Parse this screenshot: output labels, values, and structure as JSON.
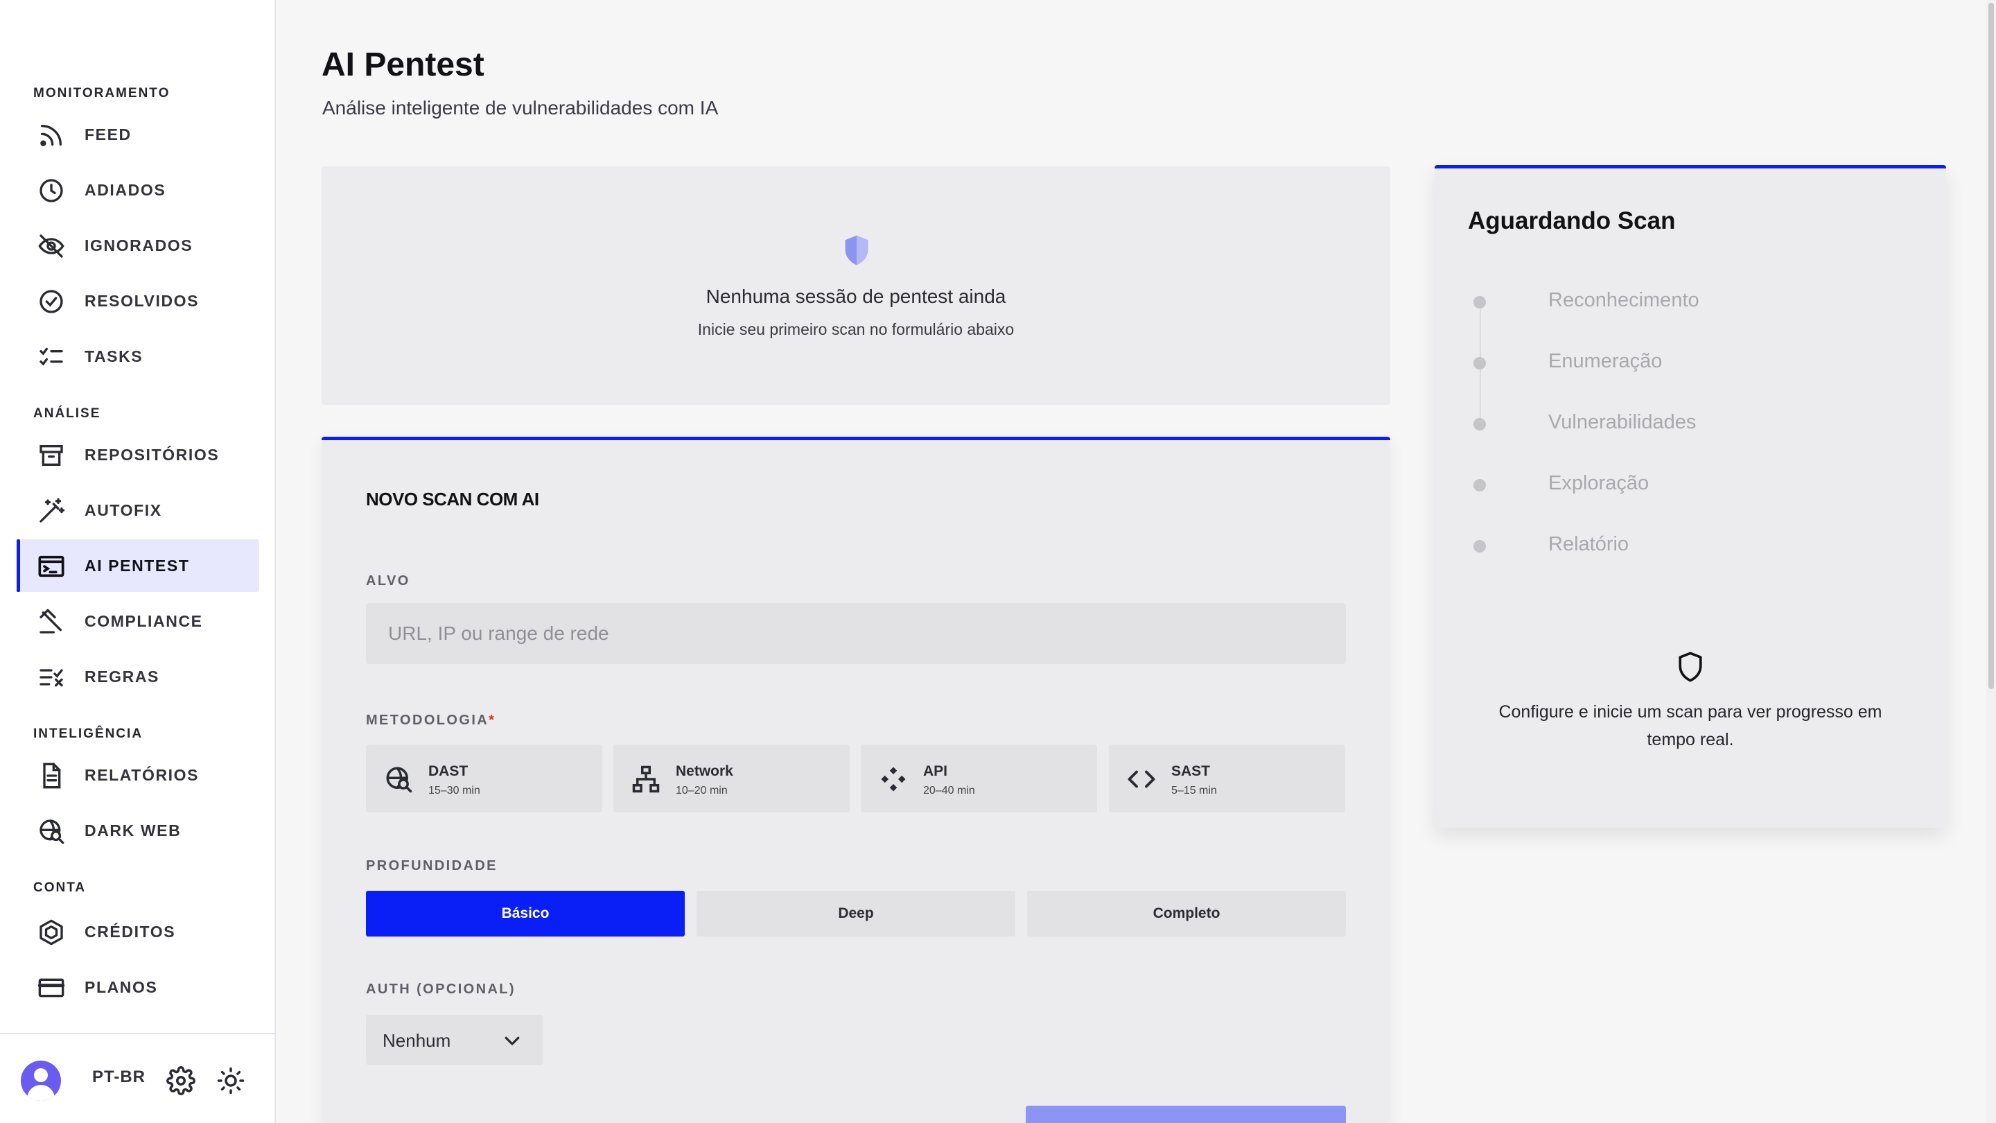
{
  "sidebar": {
    "sections": [
      {
        "title": "MONITORAMENTO",
        "items": [
          {
            "label": "FEED",
            "icon": "rss-icon"
          },
          {
            "label": "ADIADOS",
            "icon": "clock-icon"
          },
          {
            "label": "IGNORADOS",
            "icon": "eye-off-icon"
          },
          {
            "label": "RESOLVIDOS",
            "icon": "check-circle-icon"
          },
          {
            "label": "TASKS",
            "icon": "checklist-icon"
          }
        ]
      },
      {
        "title": "ANÁLISE",
        "items": [
          {
            "label": "REPOSITÓRIOS",
            "icon": "archive-icon"
          },
          {
            "label": "AUTOFIX",
            "icon": "magic-wand-icon"
          },
          {
            "label": "AI PENTEST",
            "icon": "terminal-icon",
            "active": true
          },
          {
            "label": "COMPLIANCE",
            "icon": "gavel-icon"
          },
          {
            "label": "REGRAS",
            "icon": "rules-icon"
          }
        ]
      },
      {
        "title": "INTELIGÊNCIA",
        "items": [
          {
            "label": "RELATÓRIOS",
            "icon": "document-icon"
          },
          {
            "label": "DARK WEB",
            "icon": "globe-search-icon"
          }
        ]
      },
      {
        "title": "CONTA",
        "items": [
          {
            "label": "CRÉDITOS",
            "icon": "coin-hexagon-icon"
          },
          {
            "label": "PLANOS",
            "icon": "credit-card-icon"
          }
        ]
      }
    ],
    "footer": {
      "language": "PT-BR",
      "settings_icon": "gear-icon",
      "theme_icon": "sun-icon",
      "avatar_icon": "user-avatar-icon"
    }
  },
  "header": {
    "title": "AI Pentest",
    "subtitle": "Análise inteligente de vulnerabilidades com IA"
  },
  "empty_state": {
    "icon": "shield-icon",
    "title": "Nenhuma sessão de pentest ainda",
    "subtitle": "Inicie seu primeiro scan no formulário abaixo"
  },
  "scan_form": {
    "title": "NOVO SCAN COM AI",
    "target": {
      "label": "ALVO",
      "value": "",
      "placeholder": "URL, IP ou range de rede"
    },
    "methodology": {
      "label": "METODOLOGIA",
      "required_mark": "*",
      "options": [
        {
          "name": "DAST",
          "time": "15–30 min",
          "icon": "globe-search-icon"
        },
        {
          "name": "Network",
          "time": "10–20 min",
          "icon": "network-icon"
        },
        {
          "name": "API",
          "time": "20–40 min",
          "icon": "api-icon"
        },
        {
          "name": "SAST",
          "time": "5–15 min",
          "icon": "code-icon"
        }
      ]
    },
    "depth": {
      "label": "PROFUNDIDADE",
      "options": [
        "Básico",
        "Deep",
        "Completo"
      ],
      "selected": "Básico"
    },
    "auth": {
      "label": "AUTH (OPCIONAL)",
      "value": "Nenhum"
    }
  },
  "progress": {
    "title": "Aguardando Scan",
    "steps": [
      "Reconhecimento",
      "Enumeração",
      "Vulnerabilidades",
      "Exploração",
      "Relatório"
    ],
    "icon": "shield-outline-icon",
    "message": "Configure e inicie um scan para ver progresso em tempo real."
  },
  "colors": {
    "accent": "#0a1fe8",
    "active_bg": "#e7e8fd",
    "card_bg": "#ececee",
    "page_bg": "#f6f6f7"
  }
}
